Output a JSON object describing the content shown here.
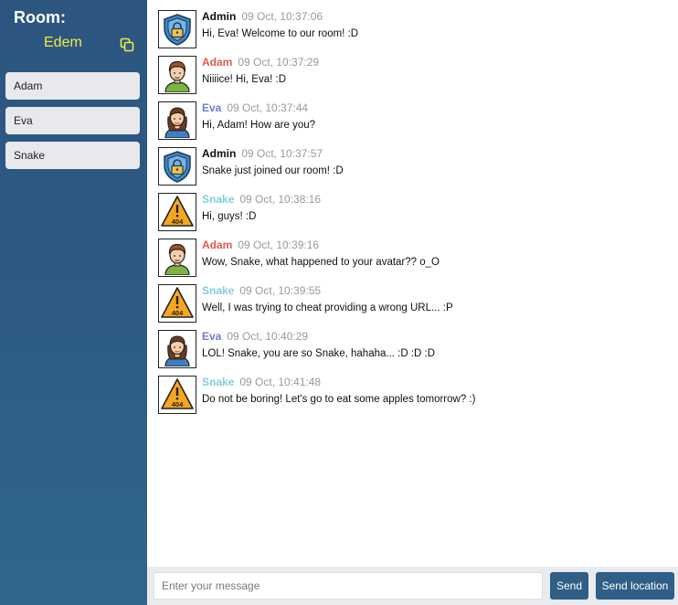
{
  "sidebar": {
    "room_title": "Room:",
    "room_name": "Edem",
    "users": [
      "Adam",
      "Eva",
      "Snake"
    ]
  },
  "colors": {
    "Admin": "#111111",
    "Adam": "#e05a4f",
    "Eva": "#6f7ed9",
    "Snake": "#7fcfd6"
  },
  "messages": [
    {
      "author": "Admin",
      "avatar": "shield-lock-icon",
      "time": "09 Oct, 10:37:06",
      "text": "Hi, Eva! Welcome to our room! :D"
    },
    {
      "author": "Adam",
      "avatar": "man-avatar-icon",
      "time": "09 Oct, 10:37:29",
      "text": "Niiiice! Hi, Eva! :D"
    },
    {
      "author": "Eva",
      "avatar": "woman-avatar-icon",
      "time": "09 Oct, 10:37:44",
      "text": "Hi, Adam! How are you?"
    },
    {
      "author": "Admin",
      "avatar": "shield-lock-icon",
      "time": "09 Oct, 10:37:57",
      "text": "Snake just joined our room! :D"
    },
    {
      "author": "Snake",
      "avatar": "warning-404-icon",
      "time": "09 Oct, 10:38:16",
      "text": "Hi, guys! :D"
    },
    {
      "author": "Adam",
      "avatar": "man-avatar-icon",
      "time": "09 Oct, 10:39:16",
      "text": "Wow, Snake, what happened to your avatar?? o_O"
    },
    {
      "author": "Snake",
      "avatar": "warning-404-icon",
      "time": "09 Oct, 10:39:55",
      "text": "Well, I was trying to cheat providing a wrong URL... :P"
    },
    {
      "author": "Eva",
      "avatar": "woman-avatar-icon",
      "time": "09 Oct, 10:40:29",
      "text": "LOL! Snake, you are so Snake, hahaha... :D :D :D"
    },
    {
      "author": "Snake",
      "avatar": "warning-404-icon",
      "time": "09 Oct, 10:41:48",
      "text": "Do not be boring! Let's go to eat some apples tomorrow? :)"
    }
  ],
  "composer": {
    "placeholder": "Enter your message",
    "value": "",
    "send_label": "Send",
    "location_label": "Send location"
  },
  "icon_text": {
    "warning": "404"
  }
}
